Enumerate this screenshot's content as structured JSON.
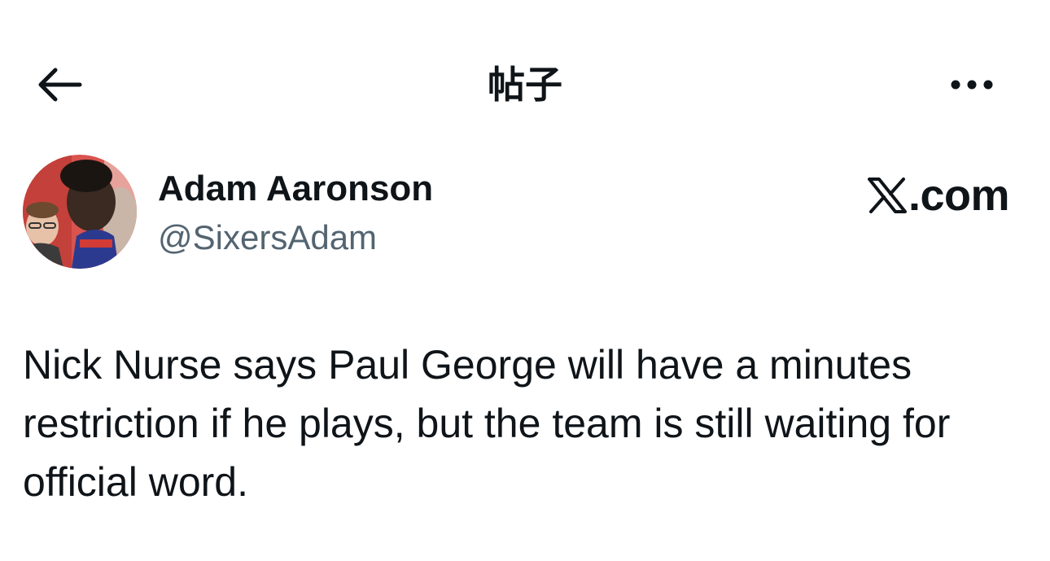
{
  "header": {
    "title": "帖子",
    "back_icon": "arrow-left-icon",
    "more_icon": "more-horizontal-icon"
  },
  "author": {
    "display_name": "Adam Aaronson",
    "handle": "@SixersAdam"
  },
  "brand": {
    "text": "X.com",
    "icon": "x-logo-icon"
  },
  "tweet": {
    "text": "Nick Nurse says Paul George will have a minutes restriction if he plays, but the team is still waiting for official word."
  },
  "colors": {
    "text_primary": "#0f1419",
    "text_secondary": "#536471",
    "background": "#ffffff"
  }
}
